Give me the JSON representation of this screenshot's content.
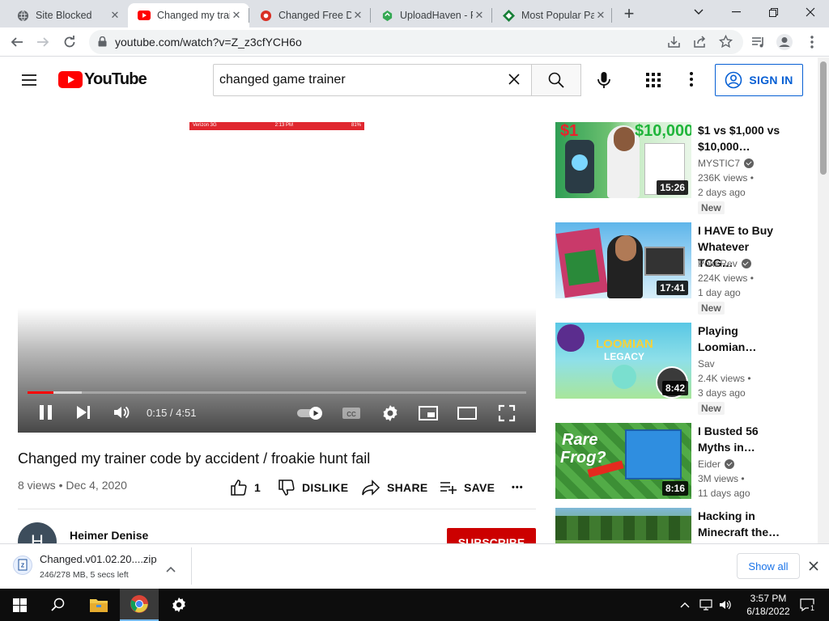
{
  "browser": {
    "tabs": [
      {
        "title": "Site Blocked",
        "active": false
      },
      {
        "title": "Changed my trainer code by accident",
        "active": true
      },
      {
        "title": "Changed Free Download",
        "active": false
      },
      {
        "title": "UploadHaven - File",
        "active": false
      },
      {
        "title": "Most Popular Pages",
        "active": false
      }
    ],
    "new_tab": "+",
    "url": "youtube.com/watch?v=Z_z3cfYCH6o"
  },
  "youtube": {
    "logo_text": "YouTube",
    "search_value": "changed game trainer",
    "sign_in": "SIGN IN"
  },
  "player": {
    "time": "0:15 / 4:51",
    "progress_fraction": 0.052,
    "phone_status": {
      "carrier": "Verizon  3G",
      "time": "2:13 PM",
      "battery": "81%"
    }
  },
  "video": {
    "title": "Changed my trainer code by accident / froakie hunt fail",
    "meta": "8 views • Dec 4, 2020",
    "likes": "1",
    "dislike": "DISLIKE",
    "share": "SHARE",
    "save": "SAVE",
    "more": "•••",
    "channel": "Heimer Denise",
    "avatar_letter": "H",
    "subscribe": "SUBSCRIBE"
  },
  "recommendations": [
    {
      "title": "$1 vs $1,000 vs $10,000…",
      "channel": "MYSTIC7",
      "verified": true,
      "views": "236K views •",
      "date": "2 days ago",
      "badge": "New",
      "duration": "15:26"
    },
    {
      "title": "I HAVE to Buy Whatever TCG…",
      "channel": "PokeRev",
      "verified": true,
      "views": "224K views •",
      "date": "1 day ago",
      "badge": "New",
      "duration": "17:41"
    },
    {
      "title": "Playing Loomian…",
      "channel": "Sav",
      "verified": false,
      "views": "2.4K views •",
      "date": "3 days ago",
      "badge": "New",
      "duration": "8:42"
    },
    {
      "title": "I Busted 56 Myths in…",
      "channel": "Eider",
      "verified": true,
      "views": "3M views •",
      "date": "11 days ago",
      "badge": "",
      "duration": "8:16"
    },
    {
      "title": "Hacking in Minecraft the…",
      "channel": "",
      "verified": false,
      "views": "",
      "date": "",
      "badge": "",
      "duration": ""
    }
  ],
  "thumb_text": {
    "t1_left": "$1",
    "t1_right": "$10,000",
    "t3_line1": "LOOMIAN",
    "t3_line2": "LEGACY",
    "t4_line1": "Rare",
    "t4_line2": "Frog?"
  },
  "download": {
    "filename": "Changed.v01.02.20....zip",
    "status": "246/278 MB, 5 secs left",
    "show_all": "Show all"
  },
  "taskbar": {
    "time": "3:57 PM",
    "date": "6/18/2022",
    "notification_count": "1"
  },
  "colors": {
    "yt_red": "#ff0000",
    "link_blue": "#065fd4",
    "subscribe_red": "#cc0000"
  }
}
